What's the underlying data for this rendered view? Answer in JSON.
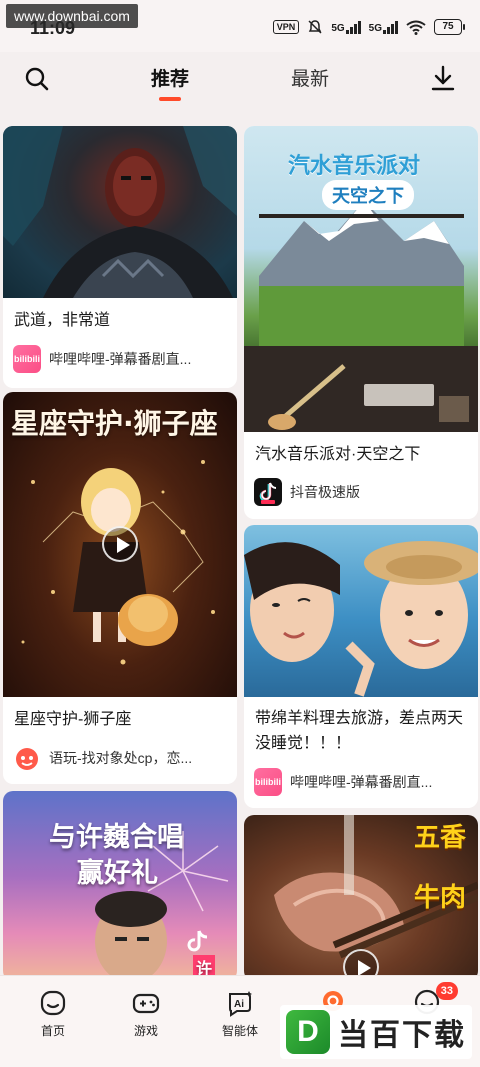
{
  "status_bar": {
    "watermark": "www.downbai.com",
    "time": "11:09",
    "vpn": "VPN",
    "sim1": "5G",
    "sim2": "5G",
    "battery": "75"
  },
  "header": {
    "tabs": [
      {
        "label": "推荐",
        "active": true
      },
      {
        "label": "最新",
        "active": false
      }
    ],
    "icons": {
      "search": "search-icon",
      "download": "download-icon"
    },
    "accent_color": "#ff4a2a"
  },
  "feed": {
    "left_column": [
      {
        "title": "武道，非常道",
        "source": "哔哩哔哩-弹幕番剧直...",
        "source_icon": "bilibili-icon",
        "thumbnail": "masked-warrior-scene"
      },
      {
        "title": "星座守护-狮子座",
        "overlay_text": "星座守护·狮子座",
        "source": "语玩-找对象处cp，恋...",
        "source_icon": "yuwan-icon",
        "thumbnail": "anime-girl-with-lion",
        "has_play_button": true
      },
      {
        "overlay_text_line1": "与许巍合唱",
        "overlay_text_line2": "赢好礼",
        "side_text": "许",
        "thumbnail": "singer-promo-fireworks"
      }
    ],
    "right_column": [
      {
        "title": "汽水音乐派对·天空之下",
        "overlay_text_line1": "汽水音乐派对",
        "overlay_text_line2": "天空之下",
        "source": "抖音极速版",
        "source_icon": "douyin-icon",
        "thumbnail": "mountain-landscape-studio"
      },
      {
        "title": "带绵羊料理去旅游，差点两天没睡觉！！！",
        "source": "哔哩哔哩-弹幕番剧直...",
        "source_icon": "bilibili-icon",
        "thumbnail": "two-girls-aquarium"
      },
      {
        "overlay_text_line1": "五香",
        "overlay_text_line2": "牛肉",
        "thumbnail": "sliced-beef-food",
        "has_play_button": true
      }
    ]
  },
  "bottom_nav": {
    "items": [
      {
        "label": "首页",
        "icon": "home-face-icon"
      },
      {
        "label": "游戏",
        "icon": "gamepad-icon"
      },
      {
        "label": "智能体",
        "icon": "ai-icon"
      },
      {
        "label": "",
        "icon": "circle-icon"
      },
      {
        "label": "",
        "icon": "message-face-icon",
        "badge": "33"
      }
    ]
  },
  "watermark_bottom": {
    "logo": "D",
    "text": "当百下载"
  }
}
